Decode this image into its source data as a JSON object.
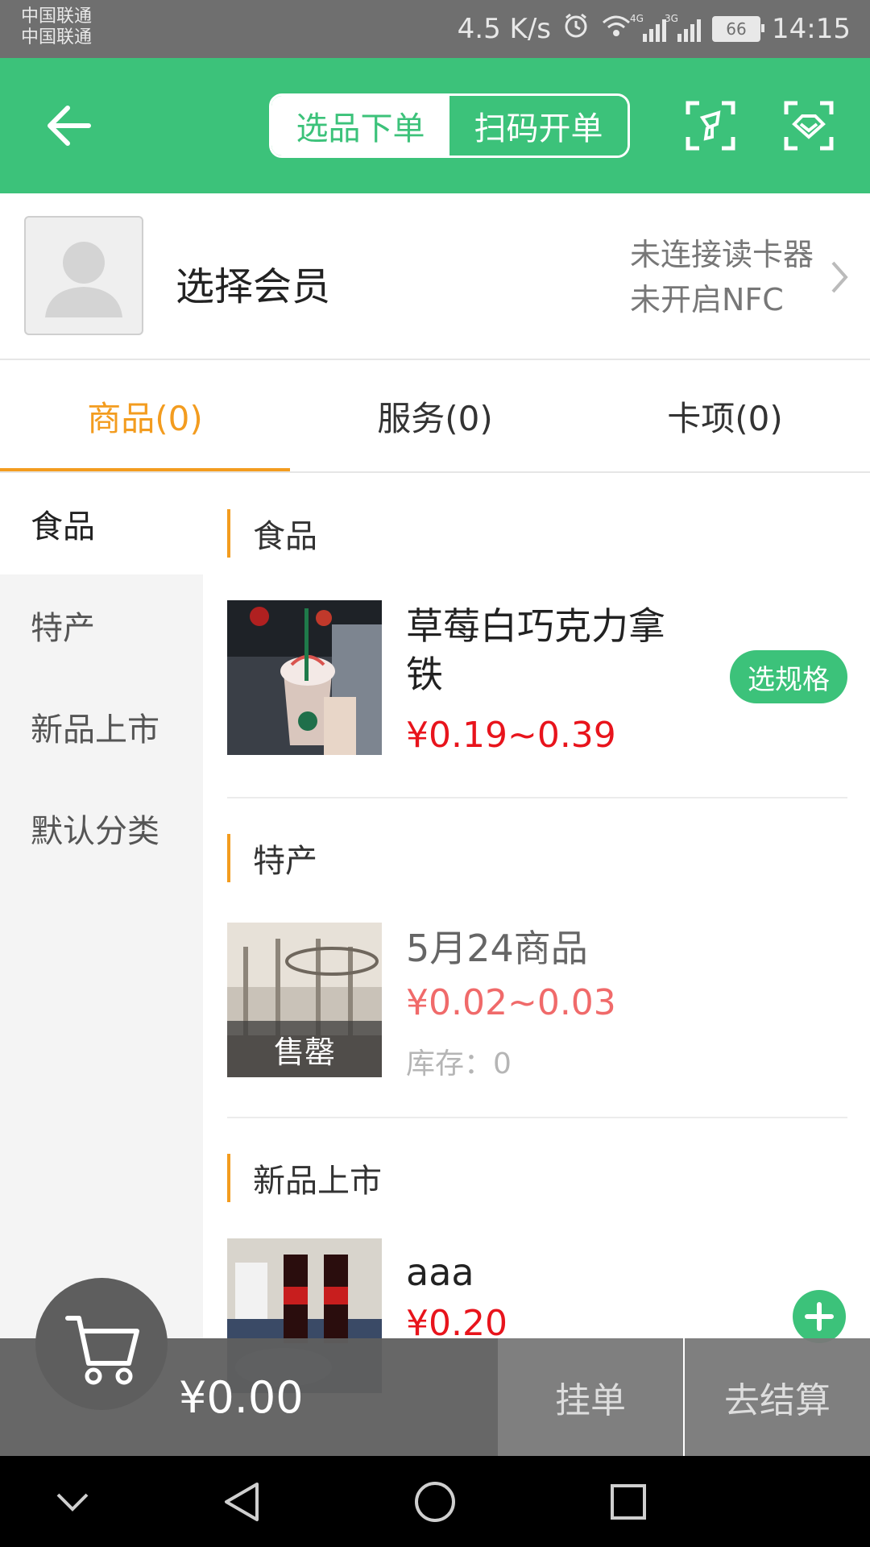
{
  "status_bar": {
    "carrier_1": "中国联通",
    "carrier_2": "中国联通",
    "speed": "4.5 K/s",
    "net1": "4G",
    "net2": "3G",
    "battery": "66",
    "time": "14:15"
  },
  "header": {
    "tab_select": "选品下单",
    "tab_scan": "扫码开单",
    "icons": [
      "back-arrow-icon",
      "scan-code-icon",
      "face-scan-icon"
    ]
  },
  "member": {
    "title": "选择会员",
    "reader_status": "未连接读卡器",
    "nfc_status": "未开启NFC"
  },
  "tabs": [
    {
      "label": "商品(0)",
      "active": true
    },
    {
      "label": "服务(0)",
      "active": false
    },
    {
      "label": "卡项(0)",
      "active": false
    }
  ],
  "categories": [
    {
      "label": "食品",
      "active": true
    },
    {
      "label": "特产",
      "active": false
    },
    {
      "label": "新品上市",
      "active": false
    },
    {
      "label": "默认分类",
      "active": false
    }
  ],
  "sections": [
    {
      "title": "食品",
      "product": {
        "name_line1": "草莓白巧克力拿",
        "name_line2": "铁",
        "price": "¥0.19~0.39",
        "action": "选规格"
      }
    },
    {
      "title": "特产",
      "product": {
        "name": "5月24商品",
        "price": "¥0.02~0.03",
        "stock": "库存：0",
        "badge": "售罄"
      }
    },
    {
      "title": "新品上市",
      "product": {
        "name": "aaa",
        "price": "¥0.20"
      }
    }
  ],
  "cart": {
    "total": "¥0.00",
    "hold_label": "挂单",
    "checkout_label": "去结算"
  },
  "colors": {
    "brand_green": "#3cc27a",
    "accent_orange": "#f39c1f",
    "price_red": "#e8141c"
  }
}
